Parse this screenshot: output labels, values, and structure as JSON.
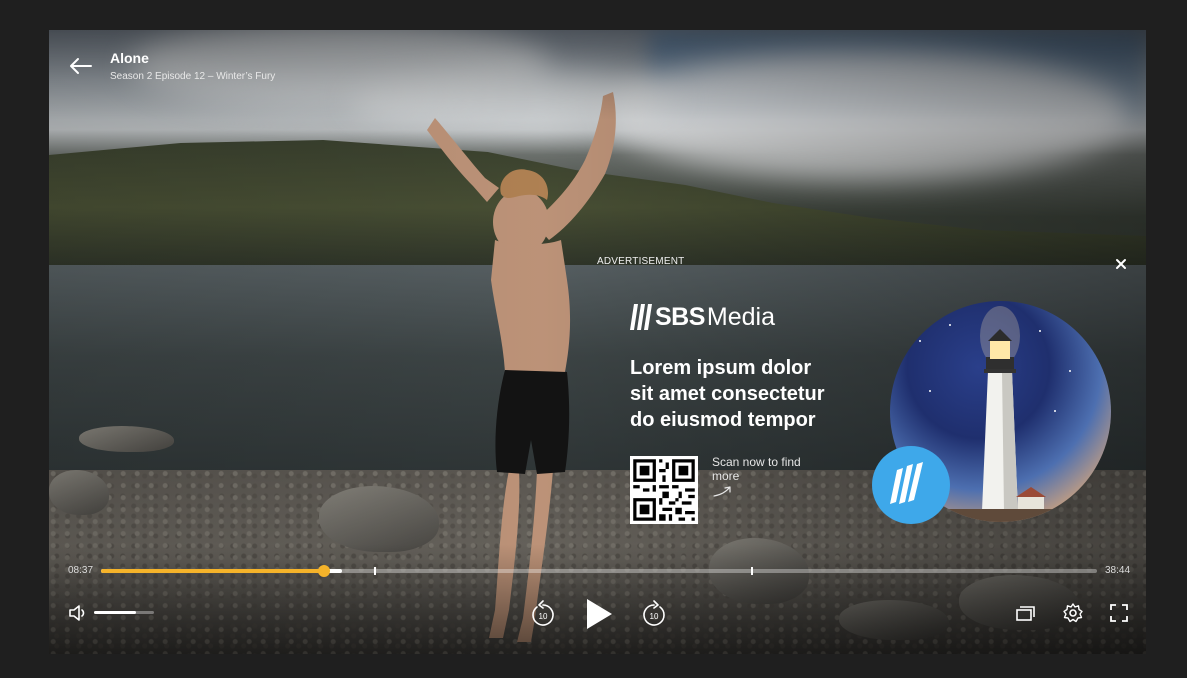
{
  "episode": {
    "title": "Alone",
    "subtitle": "Season 2 Episode 12 – Winter’s Fury"
  },
  "ad": {
    "label": "ADVERTISEMENT",
    "brand_main": "SBS",
    "brand_sub": "Media",
    "headline": [
      "Lorem ipsum dolor",
      "sit amet consectetur",
      "do eiusmod tempor"
    ],
    "scan_text": "Scan now to find more"
  },
  "playback": {
    "current_time": "08:37",
    "total_time": "38:44",
    "progress": 0.224,
    "buffered": 0.242,
    "ad_markers": [
      0.274,
      0.653
    ],
    "volume": 0.7,
    "skip_seconds": "10"
  },
  "colors": {
    "accent": "#f5b32a",
    "sbs_blue": "#3ea8ea"
  },
  "icons": [
    "back-arrow-icon",
    "close-icon",
    "volume-icon",
    "rewind-10-icon",
    "play-icon",
    "forward-10-icon",
    "episodes-icon",
    "settings-icon",
    "fullscreen-icon"
  ]
}
